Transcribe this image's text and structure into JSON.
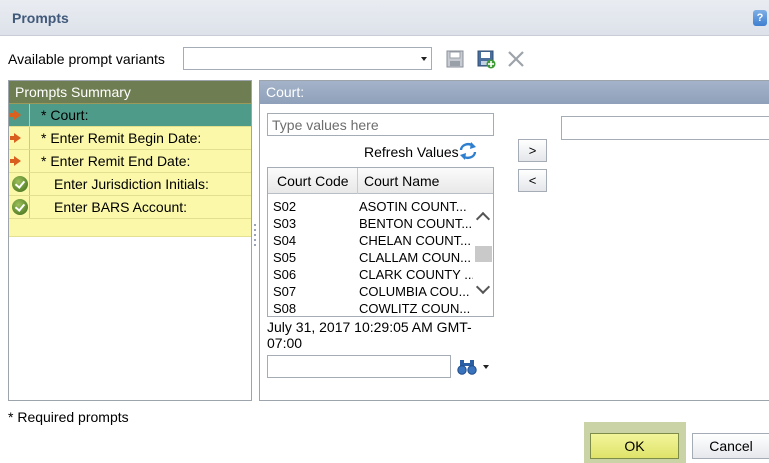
{
  "dialog": {
    "title": "Prompts",
    "help_icon": "help-icon"
  },
  "toolbar": {
    "variants_label": "Available prompt variants",
    "variant_value": "",
    "icons": [
      "save-icon",
      "save-as-icon",
      "delete-icon"
    ]
  },
  "summary": {
    "header": "Prompts Summary",
    "items": [
      {
        "label": "* Court:",
        "status": "arrow",
        "selected": true
      },
      {
        "label": "* Enter Remit Begin Date:",
        "status": "arrow",
        "selected": false
      },
      {
        "label": "* Enter Remit End Date:",
        "status": "arrow",
        "selected": false
      },
      {
        "label": "Enter Jurisdiction Initials:",
        "status": "check",
        "selected": false
      },
      {
        "label": "Enter BARS Account:",
        "status": "check",
        "selected": false
      }
    ]
  },
  "court": {
    "header": "Court:",
    "values_placeholder": "Type values here",
    "refresh_label": "Refresh Values",
    "columns": [
      "Court Code",
      "Court Name"
    ],
    "rows": [
      {
        "code": "S02",
        "name": "ASOTIN COUNT..."
      },
      {
        "code": "S03",
        "name": "BENTON COUNT..."
      },
      {
        "code": "S04",
        "name": "CHELAN COUNT..."
      },
      {
        "code": "S05",
        "name": "CLALLAM COUN..."
      },
      {
        "code": "S06",
        "name": "CLARK COUNTY ..."
      },
      {
        "code": "S07",
        "name": "COLUMBIA COU..."
      },
      {
        "code": "S08",
        "name": "COWLITZ COUN..."
      }
    ],
    "add_label": ">",
    "remove_label": "<",
    "timestamp": "July 31, 2017 10:29:05 AM GMT-07:00",
    "search_value": ""
  },
  "footer": {
    "required_note": "* Required prompts",
    "ok_label": "OK",
    "cancel_label": "Cancel"
  },
  "colors": {
    "summary_header": "#6f7d52",
    "summary_bg": "#fbf9a9",
    "selected_row": "#4f9b8a",
    "panel_header": "#97a7bf",
    "ok_button": "#e6ea7a"
  }
}
